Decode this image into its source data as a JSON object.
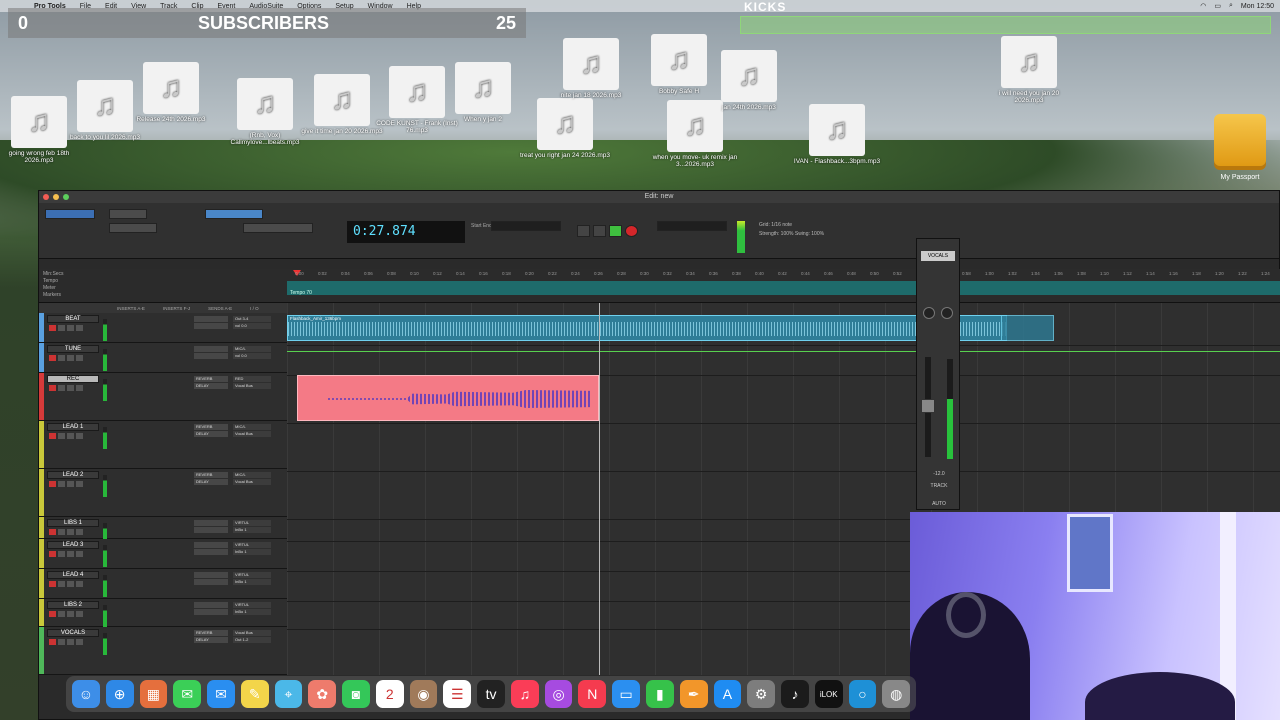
{
  "menubar": {
    "app": "Pro Tools",
    "items": [
      "File",
      "Edit",
      "View",
      "Track",
      "Clip",
      "Event",
      "AudioSuite",
      "Options",
      "Setup",
      "Window",
      "Help"
    ],
    "clock": "Mon 12:50"
  },
  "overlay": {
    "left": "0",
    "middle": "SUBSCRIBERS",
    "right": "25",
    "kicks": "KICKS"
  },
  "desktop_files": [
    "going wrong feb 18th 2026.mp3",
    "back to you lil 2026.mp3",
    "Release 24th 2026.mp3",
    "(Rnb, Vox) Callmylove...lbeats.mp3",
    "give it time jan 20 2026.mp3",
    "CODE KUNST - Frank (Inst) 76.mp3",
    "When y jan 2",
    "treat you right jan 24 2026.mp3",
    "nite jan 18 2026.mp3",
    "Bobby Safe H",
    "when you move- uk remix jan 3...2026.mp3",
    "jan 24th 2026.mp3",
    "IVAN - Flashback...3bpm.mp3",
    "i will need you jan 20 2026.mp3"
  ],
  "passport": "My Passport",
  "window": {
    "title": "Edit: new"
  },
  "counter": {
    "main": "0:27.874",
    "sub_labels": "Start\nEnd\nLength"
  },
  "grid": {
    "label": "Grid:",
    "value": "1/16 note",
    "strength": "Strength: 100% Swing: 100%"
  },
  "rulers": [
    "Min:Secs",
    "Tempo",
    "Meter",
    "Markers"
  ],
  "ticks": [
    "0:00",
    "0:02",
    "0:04",
    "0:06",
    "0:08",
    "0:10",
    "0:12",
    "0:14",
    "0:16",
    "0:18",
    "0:20",
    "0:22",
    "0:24",
    "0:26",
    "0:28",
    "0:30",
    "0:32",
    "0:34",
    "0:36",
    "0:38",
    "0:40",
    "0:42",
    "0:44",
    "0:46",
    "0:48",
    "0:50",
    "0:52",
    "0:54",
    "0:56",
    "0:58",
    "1:00",
    "1:02",
    "1:04",
    "1:06",
    "1:08",
    "1:10",
    "1:12",
    "1:14",
    "1:16",
    "1:18",
    "1:20",
    "1:22",
    "1:24"
  ],
  "tempo_lane": "Tempo 70",
  "columns": [
    "INSERTS A-E",
    "INSERTS F-J",
    "SENDS A-E",
    "I / O"
  ],
  "tracks": [
    {
      "name": "BEAT",
      "color": "#5aa0e0",
      "ins": [
        "",
        ""
      ],
      "io": [
        "Out 3-4",
        "vol 0.0"
      ]
    },
    {
      "name": "TUNE",
      "color": "#5aa0e0",
      "ins": [
        "",
        ""
      ],
      "io": [
        "MIC/L",
        "vol 0.0"
      ]
    },
    {
      "name": "REC",
      "color": "#d63a3a",
      "ins": [
        "REVERB",
        "DELAY"
      ],
      "io": [
        "RED",
        "Vocal Bus"
      ]
    },
    {
      "name": "LEAD 1",
      "color": "#c9c83a",
      "ins": [
        "REVERB",
        "DELAY"
      ],
      "io": [
        "MIC/L",
        "Vocal Bus"
      ]
    },
    {
      "name": "LEAD 2",
      "color": "#c9c83a",
      "ins": [
        "REVERB",
        "DELAY"
      ],
      "io": [
        "MIC/L",
        "Vocal Bus"
      ]
    },
    {
      "name": "LIBS 1",
      "color": "#c9c83a",
      "ins": [
        "",
        ""
      ],
      "io": [
        "VIRTUL",
        "InBo 1"
      ]
    },
    {
      "name": "LEAD 3",
      "color": "#c9c83a",
      "ins": [
        "",
        ""
      ],
      "io": [
        "VIRTUL",
        "InBo 1"
      ]
    },
    {
      "name": "LEAD 4",
      "color": "#c9c83a",
      "ins": [
        "",
        ""
      ],
      "io": [
        "VIRTUL",
        "InBo 1"
      ]
    },
    {
      "name": "LIBS 2",
      "color": "#c9c83a",
      "ins": [
        "",
        ""
      ],
      "io": [
        "VIRTUL",
        "InBo 1"
      ]
    },
    {
      "name": "VOCALS",
      "color": "#4fb85a",
      "ins": [
        "REVERB",
        "DELAY"
      ],
      "io": [
        "Vocal Bus",
        "Out 1-2"
      ]
    }
  ],
  "clips": {
    "beat": "Flashback_Amir_136bpm"
  },
  "strip": {
    "name": "VOCALS",
    "track": "TRACK",
    "auto": "AUTO",
    "vol": "-12.0"
  },
  "dock_apps": [
    {
      "icon": "finder-icon",
      "color": "#3d8ee8",
      "glyph": "☺"
    },
    {
      "icon": "safari-icon",
      "color": "#2e88e6",
      "glyph": "⊕"
    },
    {
      "icon": "launchpad-icon",
      "color": "#e56f3d",
      "glyph": "▦"
    },
    {
      "icon": "messages-icon",
      "color": "#3bcf57",
      "glyph": "✉"
    },
    {
      "icon": "mail-icon",
      "color": "#2a8ef0",
      "glyph": "✉"
    },
    {
      "icon": "notes-icon",
      "color": "#f3d54a",
      "glyph": "✎"
    },
    {
      "icon": "maps-icon",
      "color": "#4bb8e8",
      "glyph": "⌖"
    },
    {
      "icon": "photos-icon",
      "color": "#ee7b6c",
      "glyph": "✿"
    },
    {
      "icon": "facetime-icon",
      "color": "#34c759",
      "glyph": "◙"
    },
    {
      "icon": "calendar-icon",
      "color": "#ffffff",
      "glyph": "2"
    },
    {
      "icon": "contacts-icon",
      "color": "#a07a5a",
      "glyph": "◉"
    },
    {
      "icon": "reminders-icon",
      "color": "#ffffff",
      "glyph": "☰"
    },
    {
      "icon": "tv-icon",
      "color": "#222222",
      "glyph": "tv"
    },
    {
      "icon": "music-icon",
      "color": "#fa3d57",
      "glyph": "♫"
    },
    {
      "icon": "podcasts-icon",
      "color": "#a64be0",
      "glyph": "◎"
    },
    {
      "icon": "news-icon",
      "color": "#f53b4f",
      "glyph": "N"
    },
    {
      "icon": "keynote-icon",
      "color": "#2b8ff0",
      "glyph": "▭"
    },
    {
      "icon": "numbers-icon",
      "color": "#36c24a",
      "glyph": "▮"
    },
    {
      "icon": "pages-icon",
      "color": "#f2962a",
      "glyph": "✒"
    },
    {
      "icon": "appstore-icon",
      "color": "#1f8cf2",
      "glyph": "A"
    },
    {
      "icon": "settings-icon",
      "color": "#7d7d7d",
      "glyph": "⚙"
    },
    {
      "icon": "protools-icon",
      "color": "#1b1b1b",
      "glyph": "♪"
    },
    {
      "icon": "ilok-icon",
      "color": "#111111",
      "glyph": "iLOK"
    },
    {
      "icon": "siri-icon",
      "color": "#1e90d6",
      "glyph": "○"
    },
    {
      "icon": "utility-icon",
      "color": "#888888",
      "glyph": "◍"
    }
  ]
}
